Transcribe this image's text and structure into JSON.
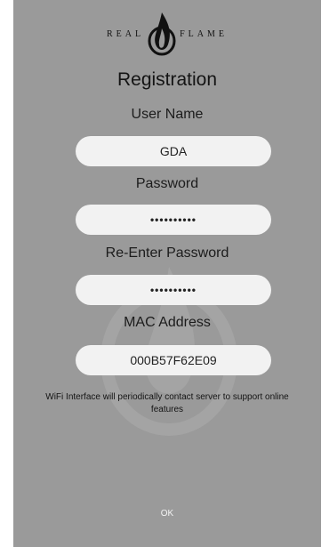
{
  "logo": {
    "left_word": "REAL",
    "right_word": "FLAME"
  },
  "title": "Registration",
  "username": {
    "label": "User Name",
    "value": "GDA"
  },
  "password": {
    "label": "Password",
    "value": "••••••••••"
  },
  "reenter_password": {
    "label": "Re-Enter Password",
    "value": "••••••••••"
  },
  "mac_address": {
    "label": "MAC Address",
    "value": "000B57F62E09"
  },
  "notice": {
    "line1": "WiFi Interface will periodically contact server to support online",
    "line2": "features"
  },
  "ok_button": {
    "label": "OK"
  }
}
